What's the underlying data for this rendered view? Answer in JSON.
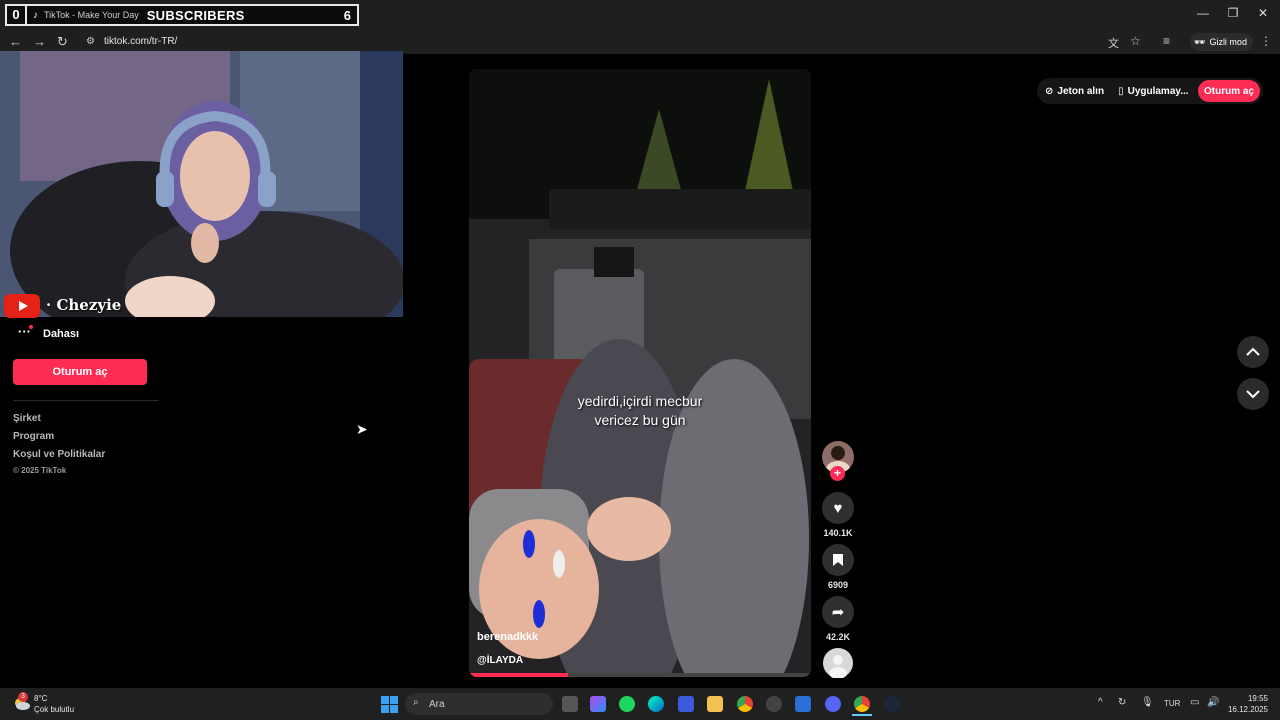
{
  "overlay": {
    "left_count": "0",
    "tab_title": "TikTok - Make Your Day",
    "label": "SUBSCRIBERS",
    "count": "6"
  },
  "browser": {
    "url": "tiktok.com/tr-TR/",
    "incognito_label": "Gizli mod"
  },
  "webcam": {
    "streamer_name": "· Chezyie"
  },
  "sidebar": {
    "more_label": "Dahası",
    "login_label": "Oturum aç",
    "links": [
      "Şirket",
      "Program",
      "Koşul ve Politikalar"
    ],
    "copyright": "© 2025 TikTok"
  },
  "video": {
    "caption_line1": "yedirdi,içirdi mecbur",
    "caption_line2": "vericez bu gün",
    "author": "berenadkkk",
    "music": "@İLAYDA",
    "progress_fraction": 0.29
  },
  "actions": {
    "likes": "140.1K",
    "saves": "6909",
    "shares": "42.2K"
  },
  "topbar": {
    "coins_label": "Jeton alın",
    "app_label": "Uygulamay...",
    "login_label": "Oturum aç"
  },
  "taskbar": {
    "temperature": "8°C",
    "weather": "Çok bulutlu",
    "search_placeholder": "Ara",
    "language": "TUR",
    "time": "19:55",
    "date": "16.12.2025"
  },
  "colors": {
    "accent": "#fe2c55",
    "youtube": "#e62117"
  }
}
